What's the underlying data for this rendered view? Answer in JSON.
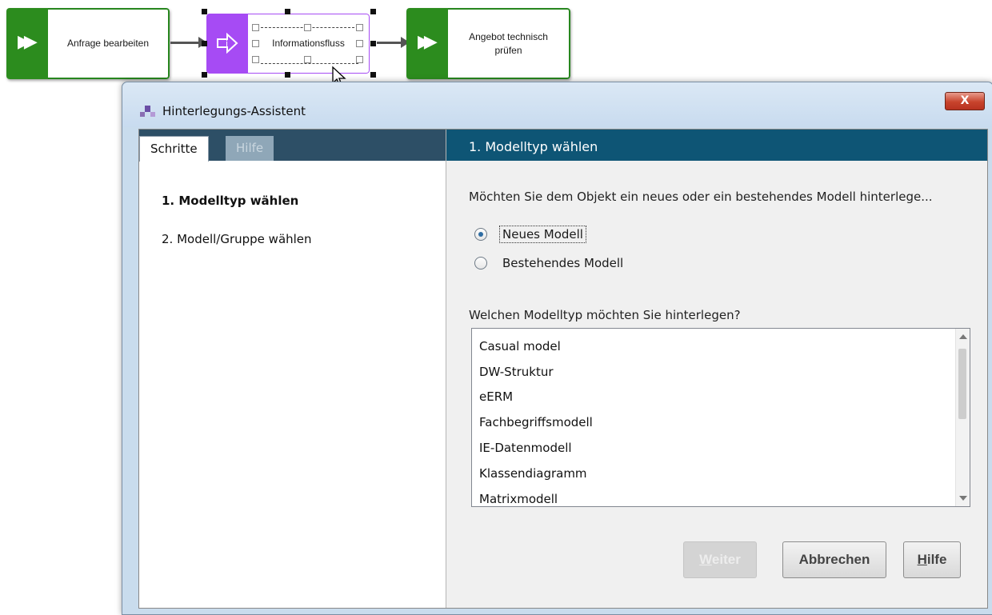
{
  "diagram": {
    "node1_label": "Anfrage bearbeiten",
    "node2_label": "Informationsfluss",
    "node3_label": "Angebot technisch prüfen",
    "function_color": "#2c8c1e",
    "information_color": "#a64bf4"
  },
  "dialog": {
    "title": "Hinterlegungs-Assistent",
    "close_label": "X",
    "tabs": {
      "steps": "Schritte",
      "help": "Hilfe"
    },
    "steps": [
      "1. Modelltyp wählen",
      "2. Modell/Gruppe wählen"
    ],
    "header": "1. Modelltyp wählen",
    "question1": "Möchten Sie dem Objekt ein neues oder ein bestehendes Modell hinterlege...",
    "radio_new": "Neues Modell",
    "radio_existing": "Bestehendes Modell",
    "selected_radio": "Neues Modell",
    "question2": "Welchen Modelltyp möchten Sie hinterlegen?",
    "model_types": [
      "Casual model",
      "DW-Struktur",
      "eERM",
      "Fachbegriffsmodell",
      "IE-Datenmodell",
      "Klassendiagramm",
      "Matrixmodell"
    ],
    "buttons": {
      "next_mnemonic": "W",
      "next_rest": "eiter",
      "cancel": "Abbrechen",
      "help_mnemonic": "H",
      "help_rest": "ilfe"
    },
    "header_color": "#0e5575"
  }
}
